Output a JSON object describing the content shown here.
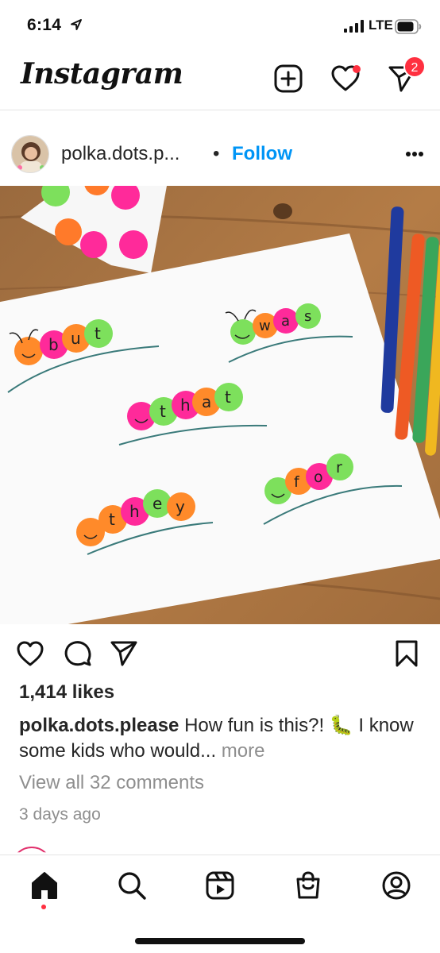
{
  "status_bar": {
    "time": "6:14",
    "network": "LTE"
  },
  "header": {
    "logo": "Instagram",
    "message_badge": "2"
  },
  "post": {
    "username": "polka.dots.p...",
    "separator": "•",
    "follow_label": "Follow",
    "likes": "1,414 likes",
    "caption_user": "polka.dots.please",
    "caption_text": "How fun is this?! 🐛 I know some kids who would...",
    "caption_more": "more",
    "view_comments": "View all 32 comments",
    "timestamp": "3 days ago",
    "photo_words": [
      "but",
      "was",
      "that",
      "for",
      "they"
    ]
  },
  "colors": {
    "follow_blue": "#0095f6",
    "badge_red": "#ff3040",
    "muted_grey": "#8e8e8e"
  }
}
